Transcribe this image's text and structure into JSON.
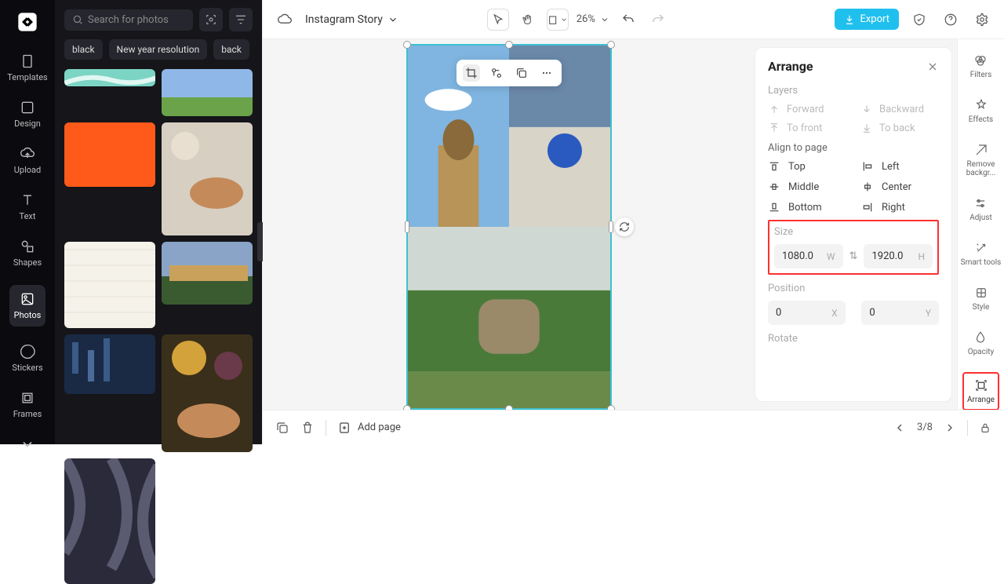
{
  "app": {
    "title": "Instagram Story"
  },
  "left_rail": {
    "items": [
      {
        "label": "Templates"
      },
      {
        "label": "Design"
      },
      {
        "label": "Upload"
      },
      {
        "label": "Text"
      },
      {
        "label": "Shapes"
      },
      {
        "label": "Photos"
      },
      {
        "label": "Stickers"
      },
      {
        "label": "Frames"
      }
    ]
  },
  "search": {
    "placeholder": "Search for photos"
  },
  "chips": [
    "black",
    "New year resolution",
    "back"
  ],
  "topbar": {
    "zoom": "26%",
    "export_label": "Export"
  },
  "arrange": {
    "title": "Arrange",
    "layers_label": "Layers",
    "actions": {
      "forward": "Forward",
      "backward": "Backward",
      "to_front": "To front",
      "to_back": "To back"
    },
    "align_label": "Align to page",
    "align": {
      "top": "Top",
      "left": "Left",
      "middle": "Middle",
      "center": "Center",
      "bottom": "Bottom",
      "right": "Right"
    },
    "size_label": "Size",
    "size": {
      "w": "1080.0",
      "h": "1920.0",
      "w_unit": "W",
      "h_unit": "H"
    },
    "position_label": "Position",
    "position": {
      "x": "0",
      "y": "0",
      "x_unit": "X",
      "y_unit": "Y"
    },
    "rotate_label": "Rotate"
  },
  "right_rail": {
    "items": [
      "Filters",
      "Effects",
      "Remove backgr...",
      "Adjust",
      "Smart tools",
      "Style",
      "Opacity",
      "Arrange"
    ]
  },
  "bottombar": {
    "add_page": "Add page",
    "page_indicator": "3/8"
  }
}
